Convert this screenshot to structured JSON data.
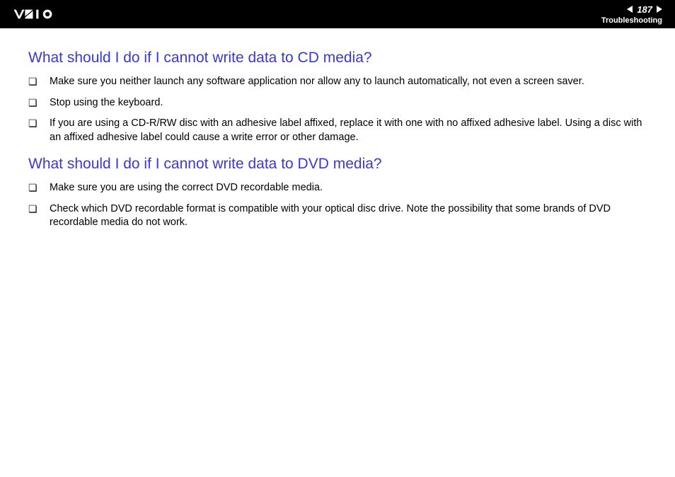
{
  "header": {
    "page_number": "187",
    "section": "Troubleshooting"
  },
  "sections": [
    {
      "heading": "What should I do if I cannot write data to CD media?",
      "bullets": [
        "Make sure you neither launch any software application nor allow any to launch automatically, not even a screen saver.",
        "Stop using the keyboard.",
        "If you are using a CD-R/RW disc with an adhesive label affixed, replace it with one with no affixed adhesive label. Using a disc with an affixed adhesive label could cause a write error or other damage."
      ]
    },
    {
      "heading": "What should I do if I cannot write data to DVD media?",
      "bullets": [
        "Make sure you are using the correct DVD recordable media.",
        "Check which DVD recordable format is compatible with your optical disc drive. Note the possibility that some brands of DVD recordable media do not work."
      ]
    }
  ]
}
